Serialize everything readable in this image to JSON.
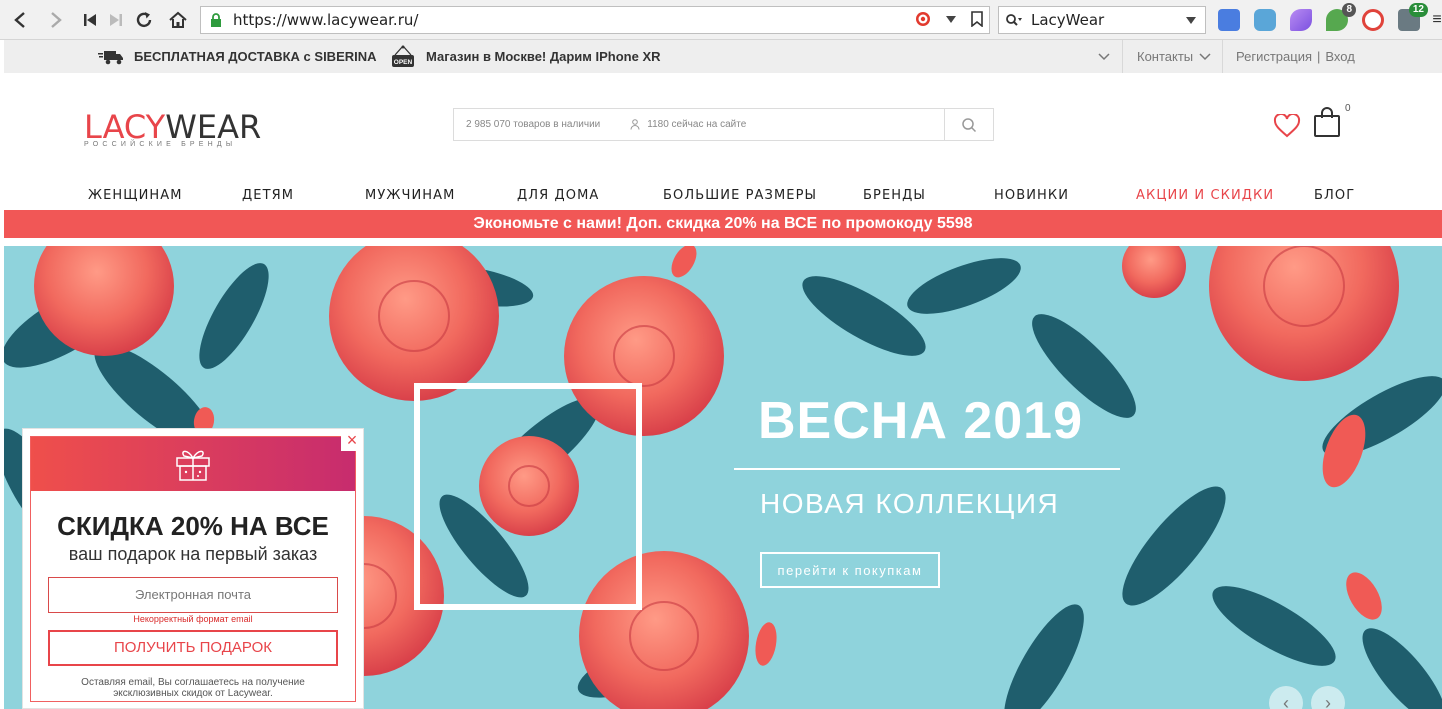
{
  "browser": {
    "url": "https://www.lacywear.ru/",
    "search_engine_value": "LacyWear",
    "ext_badges": [
      "8",
      "12"
    ]
  },
  "infobar": {
    "delivery": "БЕСПЛАТНАЯ ДОСТАВКА с SIBERINA",
    "store": "Магазин в Москве! Дарим IPhone XR",
    "open_sign": "OPEN",
    "contacts": "Контакты",
    "register": "Регистрация",
    "separator": "|",
    "login": "Вход"
  },
  "header": {
    "logo_part1": "LACY",
    "logo_part2": "WEAR",
    "logo_sub": "РОССИЙСКИЕ БРЕНДЫ",
    "search_count": "2 985 070 товаров в наличии",
    "search_online": "1180 сейчас на сайте",
    "cart_count": "0"
  },
  "menu": [
    "ЖЕНЩИНАМ",
    "ДЕТЯМ",
    "МУЖЧИНАМ",
    "ДЛЯ ДОМА",
    "БОЛЬШИЕ РАЗМЕРЫ",
    "БРЕНДЫ",
    "НОВИНКИ",
    "АКЦИИ И СКИДКИ",
    "БЛОГ"
  ],
  "promo": "Экономьте с нами! Доп. скидка 20% на ВСЕ по промокоду 5598",
  "hero": {
    "title": "ВЕСНА 2019",
    "subtitle": "НОВАЯ КОЛЛЕКЦИЯ",
    "button": "перейти к покупкам"
  },
  "popup": {
    "close": "×",
    "title": "СКИДКА 20% НА ВСЕ",
    "subtitle": "ваш подарок на первый заказ",
    "email_placeholder": "Электронная почта",
    "error": "Некорректный формат email",
    "button": "ПОЛУЧИТЬ ПОДАРОК",
    "note": "Оставляя email, Вы соглашаетесь на получение эксклюзивных скидок от Lacywear."
  },
  "colors": {
    "accent": "#e8454a",
    "promo_bg": "#f15756",
    "hero_bg": "#8fd3dc",
    "leaf": "#1e5c6b",
    "rose": "#f1695e"
  }
}
